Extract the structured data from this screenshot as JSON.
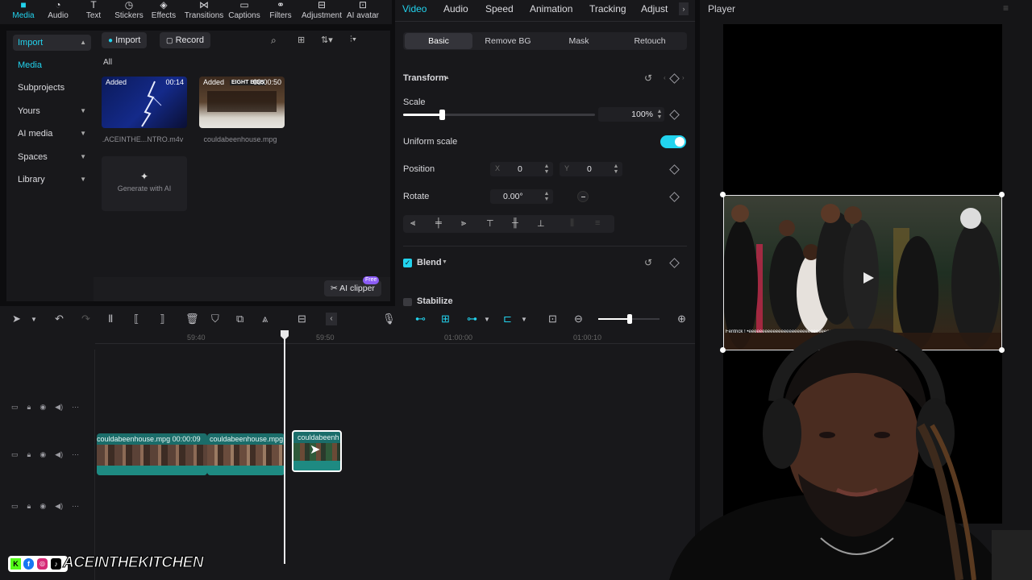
{
  "toolbar": {
    "tabs": [
      {
        "label": "Media",
        "icon": "media-icon"
      },
      {
        "label": "Audio",
        "icon": "audio-icon"
      },
      {
        "label": "Text",
        "icon": "text-icon"
      },
      {
        "label": "Stickers",
        "icon": "stickers-icon"
      },
      {
        "label": "Effects",
        "icon": "effects-icon"
      },
      {
        "label": "Transitions",
        "icon": "transitions-icon"
      },
      {
        "label": "Captions",
        "icon": "captions-icon"
      },
      {
        "label": "Filters",
        "icon": "filters-icon"
      },
      {
        "label": "Adjustment",
        "icon": "adjustment-icon"
      },
      {
        "label": "AI avatar",
        "icon": "ai-avatar-icon"
      }
    ]
  },
  "sidebar": {
    "items": [
      {
        "label": "Import"
      },
      {
        "label": "Media"
      },
      {
        "label": "Subprojects"
      },
      {
        "label": "Yours"
      },
      {
        "label": "AI media"
      },
      {
        "label": "Spaces"
      },
      {
        "label": "Library"
      }
    ]
  },
  "media": {
    "import_label": "Import",
    "record_label": "Record",
    "filter_label": "All",
    "items": [
      {
        "badge": "Added",
        "duration": "00:14",
        "filename": ".ACEINTHE...NTRO.m4v"
      },
      {
        "badge": "Added",
        "duration": "00:00:50",
        "filename": "couldabeenhouse.mpg",
        "overlay_text": "EIGHT BIGS"
      }
    ],
    "generate_label": "Generate with AI",
    "ai_clipper_label": "AI clipper",
    "ai_clipper_badge": "Free"
  },
  "props": {
    "tabs": [
      "Video",
      "Audio",
      "Speed",
      "Animation",
      "Tracking",
      "Adjust"
    ],
    "subtabs": [
      "Basic",
      "Remove BG",
      "Mask",
      "Retouch"
    ],
    "transform_label": "Transform",
    "scale_label": "Scale",
    "scale_value": "100%",
    "scale_fraction": 0.2,
    "uniform_scale_label": "Uniform scale",
    "uniform_scale_on": true,
    "position_label": "Position",
    "x_label": "X",
    "x_value": "0",
    "y_label": "Y",
    "y_value": "0",
    "rotate_label": "Rotate",
    "rotate_value": "0.00°",
    "blend_label": "Blend",
    "stabilize_label": "Stabilize"
  },
  "player": {
    "title": "Player",
    "overlay_caption": "Fentrick ! •eeeeeeeeeeeeeeeeeeeeeeeeeeeeeeeee"
  },
  "timeline": {
    "ticks": [
      "59:40",
      "59:50",
      "01:00:00",
      "01:00:10"
    ],
    "clips": [
      {
        "label": "couldabeenhouse.mpg  00:00:09"
      },
      {
        "label": "couldabeenhouse.mpg"
      },
      {
        "label": "couldabeenh"
      }
    ]
  },
  "banner": {
    "handle": "ACEINTHEKITCHEN"
  },
  "colors": {
    "accent": "#22d3ee",
    "panel": "#18181b",
    "clip": "#1b6d6a"
  }
}
